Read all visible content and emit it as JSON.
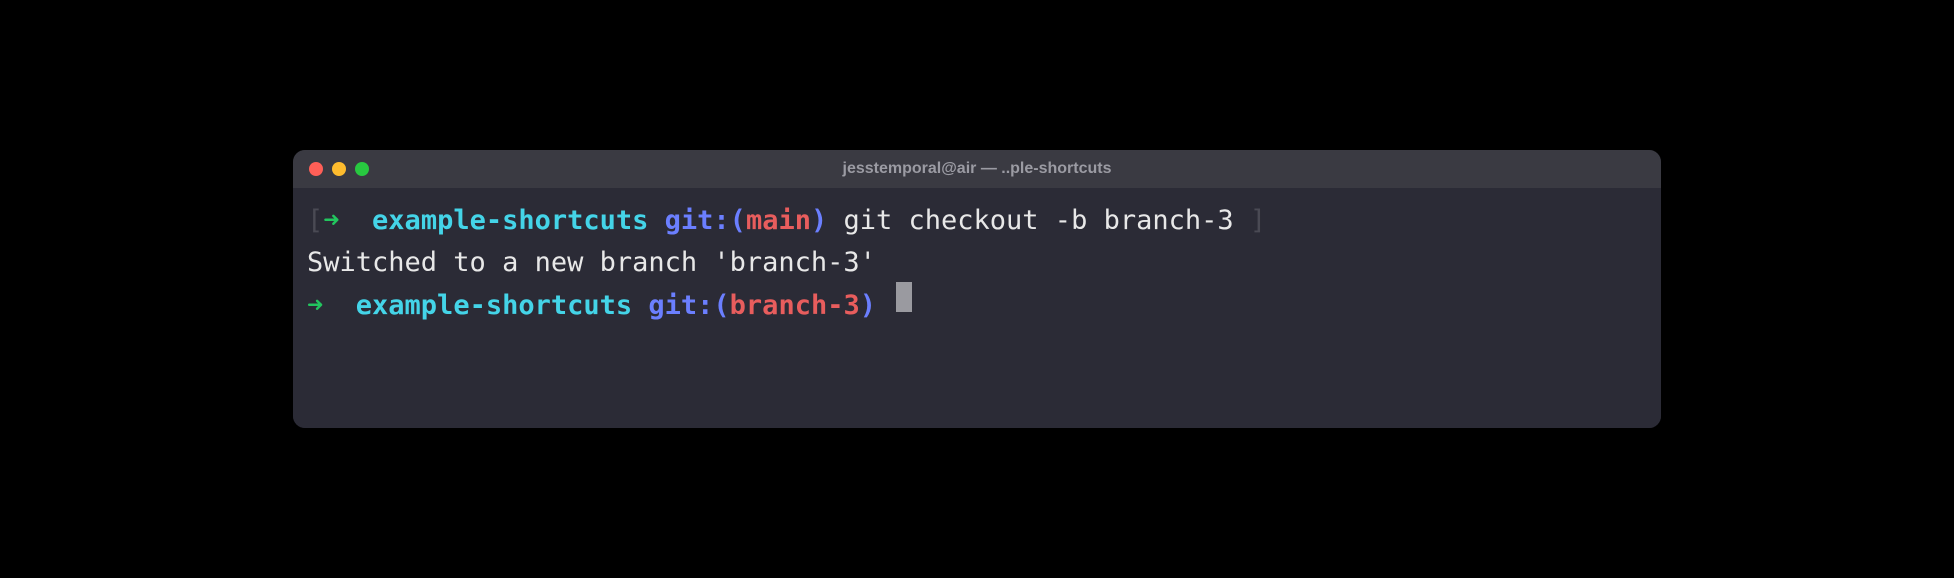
{
  "window": {
    "title": "jesstemporal@air — ..ple-shortcuts"
  },
  "colors": {
    "bg": "#2b2b36",
    "titlebar": "#3a3a42",
    "arrow": "#22c55e",
    "cwd": "#44d4e8",
    "git": "#6b7fff",
    "branch": "#e85d5d",
    "text": "#e8e8e8"
  },
  "lines": {
    "line1": {
      "bracket_open": "[",
      "arrow": "➜",
      "spacer": "  ",
      "cwd": "example-shortcuts",
      "git_prefix": " git:",
      "paren_open": "(",
      "branch": "main",
      "paren_close": ")",
      "command": " git checkout -b branch-3 ",
      "bracket_close": "]"
    },
    "line2": {
      "output": "Switched to a new branch 'branch-3'"
    },
    "line3": {
      "arrow": "➜",
      "spacer": "  ",
      "cwd": "example-shortcuts",
      "git_prefix": " git:",
      "paren_open": "(",
      "branch": "branch-3",
      "paren_close": ")",
      "trailing": " "
    }
  }
}
